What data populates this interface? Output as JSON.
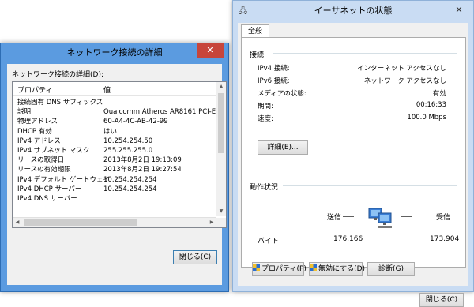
{
  "detail_window": {
    "title": "ネットワーク接続の詳細",
    "close_glyph": "✕",
    "list_label": "ネットワーク接続の詳細(D):",
    "columns": {
      "property": "プロパティ",
      "value": "値"
    },
    "rows": [
      {
        "property": "接続固有 DNS サフィックス",
        "value": ""
      },
      {
        "property": "説明",
        "value": "Qualcomm Atheros AR8161 PCI-E"
      },
      {
        "property": "物理アドレス",
        "value": "60-A4-4C-AB-42-99"
      },
      {
        "property": "DHCP 有効",
        "value": "はい"
      },
      {
        "property": "IPv4 アドレス",
        "value": "10.254.254.50"
      },
      {
        "property": "IPv4 サブネット マスク",
        "value": "255.255.255.0"
      },
      {
        "property": "リースの取得日",
        "value": "2013年8月2日 19:13:09"
      },
      {
        "property": "リースの有効期限",
        "value": "2013年8月2日 19:27:54"
      },
      {
        "property": "IPv4 デフォルト ゲートウェイ",
        "value": "10.254.254.254"
      },
      {
        "property": "IPv4 DHCP サーバー",
        "value": "10.254.254.254"
      },
      {
        "property": "IPv4 DNS サーバー",
        "value": ""
      }
    ],
    "close_button": "閉じる(C)"
  },
  "status_window": {
    "title": "イーサネットの状態",
    "close_glyph": "✕",
    "tab_general": "全般",
    "connection": {
      "heading": "接続",
      "ipv4_label": "IPv4 接続:",
      "ipv4_value": "インターネット アクセスなし",
      "ipv6_label": "IPv6 接続:",
      "ipv6_value": "ネットワーク アクセスなし",
      "media_label": "メディアの状態:",
      "media_value": "有効",
      "duration_label": "期間:",
      "duration_value": "00:16:33",
      "speed_label": "速度:",
      "speed_value": "100.0 Mbps"
    },
    "details_button": "詳細(E)...",
    "activity": {
      "heading": "動作状況",
      "sent_label": "送信",
      "received_label": "受信",
      "bytes_label": "バイト:",
      "sent_bytes": "176,166",
      "received_bytes": "173,904"
    },
    "properties_button": "プロパティ(P)",
    "disable_button": "無効にする(D)",
    "diagnose_button": "診断(G)",
    "close_button": "閉じる(C)"
  }
}
